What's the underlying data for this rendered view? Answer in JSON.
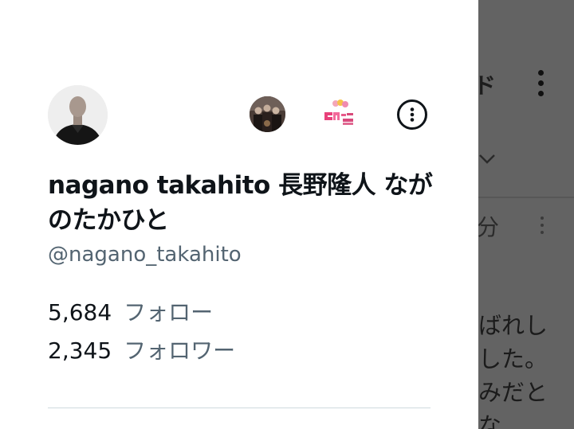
{
  "background": {
    "title_fragment": "ド",
    "time_fragment": "分",
    "text_lines": [
      "ばれし",
      "した。",
      "みだと",
      "な"
    ]
  },
  "profile": {
    "display_name": "nagano takahito 長野隆人 ながのたかひと",
    "handle": "@nagano_takahito",
    "following_count": "5,684",
    "following_label": "フォロー",
    "followers_count": "2,345",
    "followers_label": "フォロワー"
  },
  "icons": {
    "more": "more-options-icon",
    "kebab": "kebab-menu-icon",
    "chevron": "chevron-down-icon"
  },
  "colors": {
    "text_primary": "#0f1419",
    "text_secondary": "#536471",
    "overlay": "#636363",
    "divider": "#cfd9de"
  }
}
